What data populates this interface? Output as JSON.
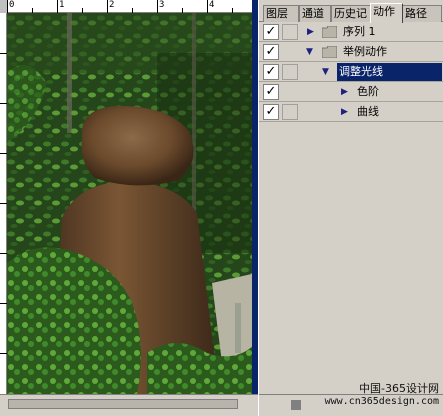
{
  "ruler": {
    "top_labels": [
      "0",
      "1",
      "2",
      "3",
      "4"
    ]
  },
  "photo": {
    "description_icon": "image"
  },
  "palette": {
    "tabs": [
      {
        "label": "图层",
        "active": false
      },
      {
        "label": "通道",
        "active": false
      },
      {
        "label": "历史记",
        "active": false
      },
      {
        "label": "动作",
        "active": true
      },
      {
        "label": "路径",
        "active": false
      }
    ],
    "actions": [
      {
        "label": "序列 1",
        "checked": true,
        "expanded": false,
        "type": "set",
        "selected": false
      },
      {
        "label": "举例动作",
        "checked": true,
        "expanded": true,
        "type": "set",
        "selected": false
      },
      {
        "label": "调整光线",
        "checked": true,
        "expanded": true,
        "type": "action",
        "selected": true
      },
      {
        "label": "色阶",
        "checked": true,
        "expanded": false,
        "type": "step",
        "selected": false
      },
      {
        "label": "曲线",
        "checked": true,
        "expanded": false,
        "type": "step",
        "selected": false
      }
    ]
  },
  "watermark": {
    "line1": "中国-365设计网",
    "line2": "www.cn365design.com"
  },
  "colors": {
    "selection": "#0a246a",
    "panel_bg": "#d4d0c8",
    "foliage": "#2c5a1e",
    "rock": "#6b4a2c"
  }
}
